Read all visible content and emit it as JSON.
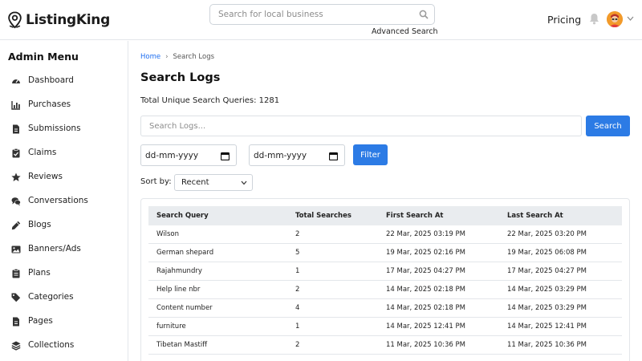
{
  "header": {
    "logo_text": "ListingKing",
    "search_placeholder": "Search for local business",
    "advanced_search": "Advanced Search",
    "pricing": "Pricing"
  },
  "sidebar": {
    "title": "Admin Menu",
    "items": [
      {
        "label": "Dashboard",
        "icon": "gauge-icon"
      },
      {
        "label": "Purchases",
        "icon": "chart-icon"
      },
      {
        "label": "Submissions",
        "icon": "file-icon"
      },
      {
        "label": "Claims",
        "icon": "clipboard-check-icon"
      },
      {
        "label": "Reviews",
        "icon": "star-icon"
      },
      {
        "label": "Conversations",
        "icon": "comments-icon"
      },
      {
        "label": "Blogs",
        "icon": "pencil-icon"
      },
      {
        "label": "Banners/Ads",
        "icon": "image-icon"
      },
      {
        "label": "Plans",
        "icon": "clipboard-icon"
      },
      {
        "label": "Categories",
        "icon": "tags-icon"
      },
      {
        "label": "Pages",
        "icon": "file-icon"
      },
      {
        "label": "Collections",
        "icon": "layers-icon"
      }
    ]
  },
  "breadcrumb": {
    "home": "Home",
    "separator": "›",
    "current": "Search Logs"
  },
  "page": {
    "title": "Search Logs",
    "total_queries": "Total Unique Search Queries: 1281",
    "search_placeholder": "Search Logs...",
    "search_button": "Search",
    "date_from": "dd-mm-yyyy",
    "date_to": "dd-mm-yyyy",
    "filter_button": "Filter",
    "sort_label": "Sort by:",
    "sort_value": "Recent"
  },
  "table": {
    "headers": [
      "Search Query",
      "Total Searches",
      "First Search At",
      "Last Search At"
    ],
    "rows": [
      [
        "Wilson",
        "2",
        "22 Mar, 2025 03:19 PM",
        "22 Mar, 2025 03:20 PM"
      ],
      [
        "German shepard",
        "5",
        "19 Mar, 2025 02:16 PM",
        "19 Mar, 2025 06:08 PM"
      ],
      [
        "Rajahmundry",
        "1",
        "17 Mar, 2025 04:27 PM",
        "17 Mar, 2025 04:27 PM"
      ],
      [
        "Help line nbr",
        "2",
        "14 Mar, 2025 02:18 PM",
        "14 Mar, 2025 03:29 PM"
      ],
      [
        "Content number",
        "4",
        "14 Mar, 2025 02:18 PM",
        "14 Mar, 2025 03:29 PM"
      ],
      [
        "furniture",
        "1",
        "14 Mar, 2025 12:41 PM",
        "14 Mar, 2025 12:41 PM"
      ],
      [
        "Tibetan Mastiff",
        "2",
        "11 Mar, 2025 10:36 PM",
        "11 Mar, 2025 10:36 PM"
      ]
    ]
  },
  "colors": {
    "primary": "#2c7be5",
    "link": "#1e6ef0",
    "table_header_bg": "#e9ecef",
    "avatar": "#f29a2a"
  }
}
